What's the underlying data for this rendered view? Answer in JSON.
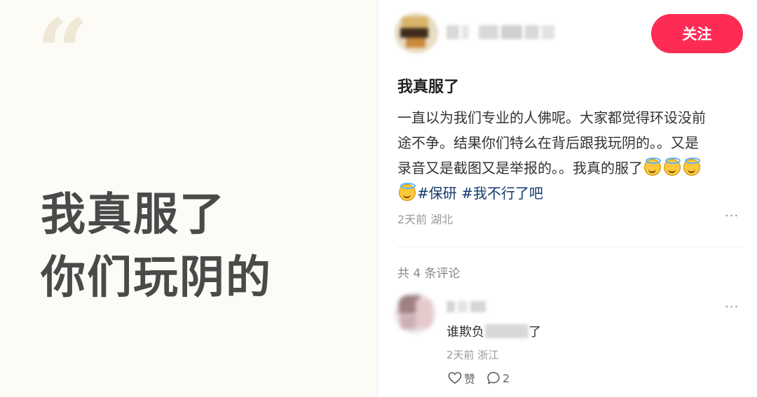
{
  "left_card": {
    "quote_mark": "“",
    "line1": "我真服了",
    "line2": "你们玩阴的"
  },
  "post": {
    "follow_label": "关注",
    "title": "我真服了",
    "body_line1": "一直以为我们专业的人佛呢。大家都觉得环设没前",
    "body_line2": "途不争。结果你们特么在背后跟我玩阴的。。又是",
    "body_line3": "录音又是截图又是举报的。。我真的服了",
    "hashtags": [
      "#保研",
      "#我不行了吧"
    ],
    "time": "2天前",
    "location": "湖北",
    "more": "···"
  },
  "comments": {
    "count_label": "共 4 条评论",
    "items": [
      {
        "text_before": "谁欺负",
        "text_after": "了",
        "time": "2天前",
        "location": "浙江",
        "like_label": "赞",
        "reply_count": "2",
        "more": "···"
      }
    ]
  },
  "icons": {
    "emoji": "smiling-face-with-halo",
    "like": "heart-outline",
    "reply": "speech-bubble-outline"
  },
  "colors": {
    "follow_button": "#fe2c55",
    "hashtag": "#13386c",
    "left_background": "#fcfbf6",
    "quote_mark": "#efe8d7"
  }
}
